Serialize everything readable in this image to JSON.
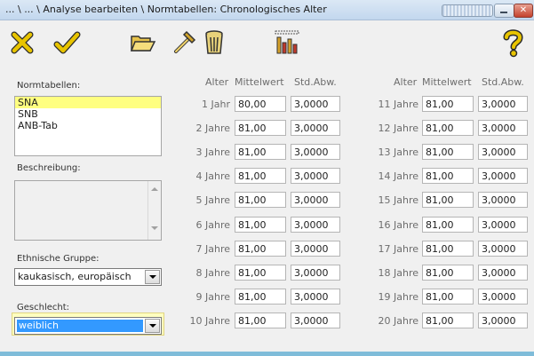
{
  "window": {
    "title": "... \\ ... \\ Analyse bearbeiten \\ Normtabellen: Chronologisches Alter",
    "close_glyph": "✕"
  },
  "toolbar": {
    "icons": [
      "cancel-icon",
      "confirm-icon",
      "open-folder-icon",
      "hammer-icon",
      "trash-icon",
      "chart-icon",
      "help-icon"
    ]
  },
  "left_panel": {
    "normtabellen_label": "Normtabellen:",
    "normtabellen_items": [
      "SNA",
      "SNB",
      "ANB-Tab"
    ],
    "beschreibung_label": "Beschreibung:",
    "ethnic_label": "Ethnische Gruppe:",
    "ethnic_value": "kaukasisch, europäisch",
    "gender_label": "Geschlecht:",
    "gender_value": "weiblich"
  },
  "table": {
    "headers": {
      "alter": "Alter",
      "mittelwert": "Mittelwert",
      "stdabw": "Std.Abw."
    },
    "left_rows": [
      {
        "age": "1 Jahr",
        "mean": "80,00",
        "sd": "3,0000"
      },
      {
        "age": "2 Jahre",
        "mean": "81,00",
        "sd": "3,0000"
      },
      {
        "age": "3 Jahre",
        "mean": "81,00",
        "sd": "3,0000"
      },
      {
        "age": "4 Jahre",
        "mean": "81,00",
        "sd": "3,0000"
      },
      {
        "age": "5 Jahre",
        "mean": "81,00",
        "sd": "3,0000"
      },
      {
        "age": "6 Jahre",
        "mean": "81,00",
        "sd": "3,0000"
      },
      {
        "age": "7 Jahre",
        "mean": "81,00",
        "sd": "3,0000"
      },
      {
        "age": "8 Jahre",
        "mean": "81,00",
        "sd": "3,0000"
      },
      {
        "age": "9 Jahre",
        "mean": "81,00",
        "sd": "3,0000"
      },
      {
        "age": "10 Jahre",
        "mean": "81,00",
        "sd": "3,0000"
      }
    ],
    "right_rows": [
      {
        "age": "11 Jahre",
        "mean": "81,00",
        "sd": "3,0000"
      },
      {
        "age": "12 Jahre",
        "mean": "81,00",
        "sd": "3,0000"
      },
      {
        "age": "13 Jahre",
        "mean": "81,00",
        "sd": "3,0000"
      },
      {
        "age": "14 Jahre",
        "mean": "81,00",
        "sd": "3,0000"
      },
      {
        "age": "15 Jahre",
        "mean": "81,00",
        "sd": "3,0000"
      },
      {
        "age": "16 Jahre",
        "mean": "81,00",
        "sd": "3,0000"
      },
      {
        "age": "17 Jahre",
        "mean": "81,00",
        "sd": "3,0000"
      },
      {
        "age": "18 Jahre",
        "mean": "81,00",
        "sd": "3,0000"
      },
      {
        "age": "19 Jahre",
        "mean": "81,00",
        "sd": "3,0000"
      },
      {
        "age": "20 Jahre",
        "mean": "81,00",
        "sd": "3,0000"
      }
    ]
  },
  "colors": {
    "selection_yellow": "#ffff80",
    "combo_highlight": "#3399ff"
  }
}
